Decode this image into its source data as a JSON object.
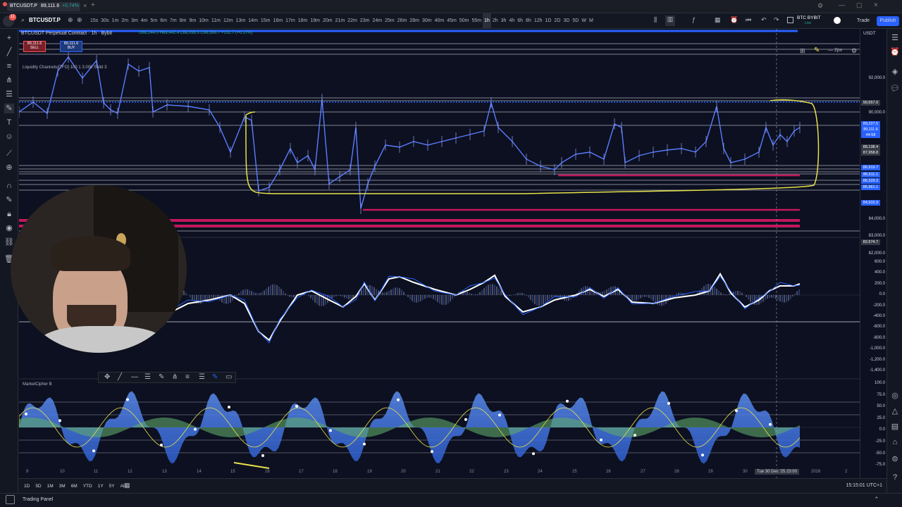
{
  "browser": {
    "tab_title": "BTCUSDT.P",
    "tab_price": "89,111.6",
    "tab_change": "+0.74%",
    "notification_count": "11"
  },
  "toolbar": {
    "symbol": "BTCUSDT.P",
    "timeframes": [
      "15s",
      "30s",
      "1m",
      "2m",
      "3m",
      "4m",
      "5m",
      "6m",
      "7m",
      "8m",
      "9m",
      "10m",
      "11m",
      "12m",
      "13m",
      "14m",
      "15m",
      "16m",
      "17m",
      "18m",
      "19m",
      "20m",
      "21m",
      "22m",
      "23m",
      "24m",
      "25m",
      "26m",
      "28m",
      "30m",
      "40m",
      "45m",
      "50m",
      "55m",
      "1h",
      "2h",
      "3h",
      "4h",
      "6h",
      "8h",
      "12h",
      "1D",
      "2D",
      "3D",
      "5D",
      "W",
      "M"
    ],
    "active_timeframe": "1h",
    "exchange_label": "BTC BYBIT",
    "exchange_sub": "Live",
    "trade_button": "Trade",
    "publish_button": "Publish",
    "currency": "USDT"
  },
  "legend": {
    "title": "BTCUSDT Perpetual Contract · 1h · Bybit",
    "ohlc": "O88,244.0 H88,442.4 L88,038.3 C88,396.7 +152.7 (+0.17%)",
    "sell_price": "89,111.6",
    "sell_label": "SELL",
    "buy_price": "89,111.6",
    "buy_label": "BUY",
    "indicator": "Liquidity Channels [TFO] 100 1 3.000 Solid 3",
    "marketcipher_label": "MarketCipher B"
  },
  "price_axis": {
    "labels": [
      {
        "text": "92,000.0"
      },
      {
        "text": "90,657.0"
      },
      {
        "text": "90,000.0"
      },
      {
        "text": "89,227.5"
      },
      {
        "text": "89,111.6"
      },
      {
        "text": "44:58"
      },
      {
        "text": "88,138.4"
      },
      {
        "text": "87,958.8"
      },
      {
        "text": "86,919.7"
      },
      {
        "text": "86,611.1"
      },
      {
        "text": "86,329.3"
      },
      {
        "text": "85,961.1"
      },
      {
        "text": "84,915.9"
      },
      {
        "text": "84,000.0"
      },
      {
        "text": "83,000.0"
      },
      {
        "text": "82,674.7"
      },
      {
        "text": "82,000.0"
      }
    ],
    "osc_labels": [
      "600.0",
      "400.0",
      "200.0",
      "0.0",
      "-200.0",
      "-400.0",
      "-600.0",
      "-800.0",
      "-1,000.0",
      "-1,200.0",
      "-1,400.0"
    ],
    "mc_labels": [
      "100.0",
      "75.0",
      "50.0",
      "25.0",
      "0.0",
      "-25.0",
      "-50.0",
      "-75.0"
    ]
  },
  "time_axis": {
    "labels": [
      "9",
      "10",
      "11",
      "12",
      "13",
      "14",
      "15",
      "16",
      "17",
      "18",
      "19",
      "20",
      "21",
      "22",
      "23",
      "24",
      "25",
      "26",
      "27",
      "28",
      "29",
      "30",
      "31",
      "2026",
      "2"
    ],
    "crosshair_label": "Tue 30 Dec '25",
    "crosshair_time": "23:00"
  },
  "bottom_bar": {
    "ranges": [
      "1D",
      "5D",
      "1M",
      "3M",
      "6M",
      "YTD",
      "1Y",
      "5Y",
      "All"
    ],
    "clock": "15:15:01 UTC+1"
  },
  "status_bar": {
    "panel_label": "Trading Panel"
  },
  "colors": {
    "accent": "#2962ff",
    "candle": "#5b7cff",
    "yellow_annotation": "#e8e24a",
    "red_level": "#c2185b",
    "background": "#0c1020"
  }
}
